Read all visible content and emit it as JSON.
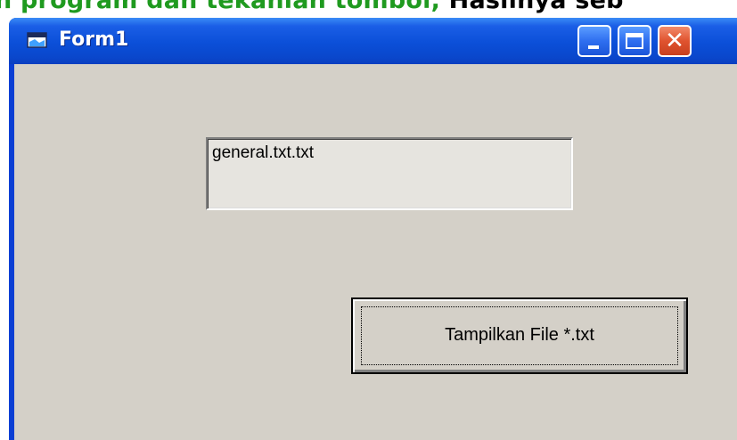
{
  "caption": {
    "green_text": "n program dan tekanlah tombol,",
    "black_text": " Hasilnya seb"
  },
  "window": {
    "title": "Form1",
    "icon": "form-window-icon",
    "controls": {
      "minimize": "minimize-icon",
      "maximize": "maximize-icon",
      "close": "close-icon",
      "close_glyph": "✕"
    }
  },
  "form": {
    "textbox_value": "general.txt.txt",
    "button_label": "Tampilkan File *.txt"
  },
  "colors": {
    "titlebar": "#0b4fd8",
    "client_background": "#d4d0c8",
    "close_button": "#e0532f",
    "caption_green": "#1f9a1f"
  }
}
